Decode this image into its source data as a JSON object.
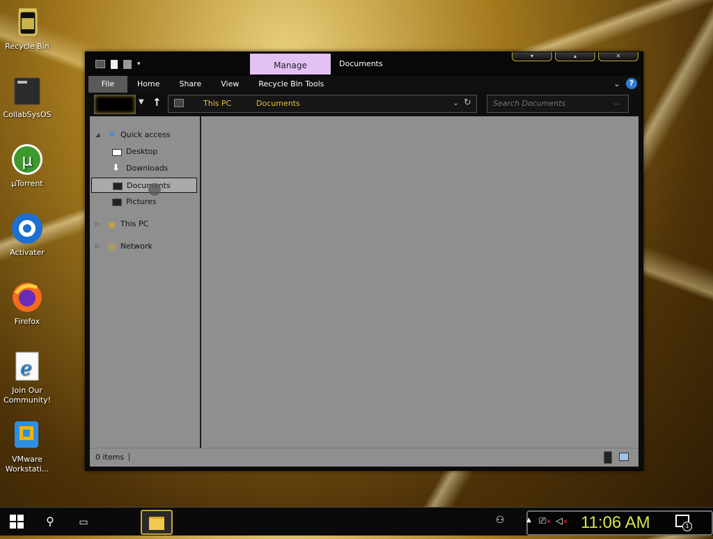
{
  "desktop": {
    "icons": [
      {
        "label": "Recycle Bin",
        "icon": "recycle-bin-icon"
      },
      {
        "label": "CollabSysOS",
        "icon": "folder-icon"
      },
      {
        "label": "µTorrent",
        "icon": "utorrent-icon"
      },
      {
        "label": "Activater",
        "icon": "activater-icon"
      },
      {
        "label": "Firefox",
        "icon": "firefox-icon"
      },
      {
        "label": "Join Our Community!",
        "icon": "internet-explorer-icon"
      },
      {
        "label": "VMware Workstati...",
        "icon": "vmware-icon"
      }
    ]
  },
  "window": {
    "title": "Documents",
    "context_tab": "Manage",
    "ribbon_tabs": [
      "File",
      "Home",
      "Share",
      "View",
      "Recycle Bin Tools"
    ],
    "address": {
      "crumbs": [
        "This PC",
        "Documents"
      ]
    },
    "search": {
      "placeholder": "Search Documents"
    },
    "nav_pane": {
      "quick_access": "Quick access",
      "items": [
        "Desktop",
        "Downloads",
        "Documents",
        "Pictures"
      ],
      "this_pc": "This PC",
      "network": "Network"
    },
    "status": {
      "items_text": "0 items"
    }
  },
  "taskbar": {
    "clock": "11:06 AM",
    "notification_count": "1"
  },
  "colors": {
    "accent": "#e6c23a",
    "manage_tab": "#e4c1f4",
    "clock": "#d7e64a"
  }
}
